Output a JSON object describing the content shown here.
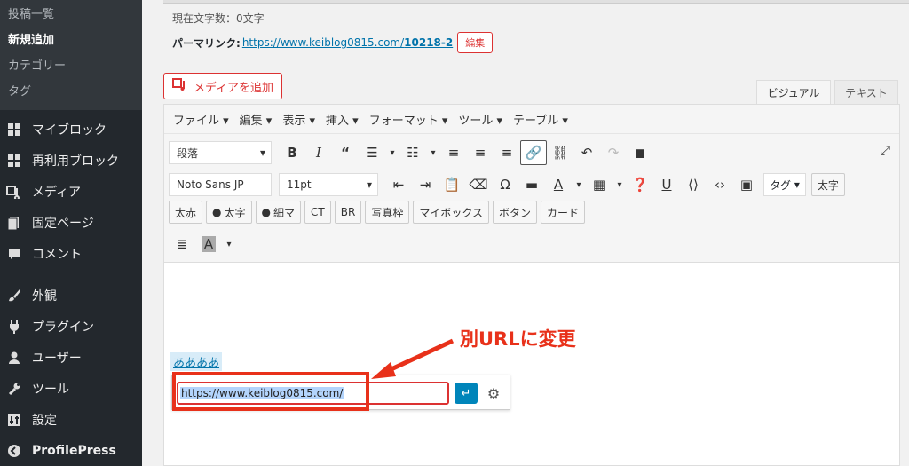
{
  "sidebar": {
    "submenu": [
      {
        "label": "投稿一覧",
        "current": false
      },
      {
        "label": "新規追加",
        "current": true
      },
      {
        "label": "カテゴリー",
        "current": false
      },
      {
        "label": "タグ",
        "current": false
      }
    ],
    "items": [
      {
        "label": "マイブロック",
        "icon": "grid-icon"
      },
      {
        "label": "再利用ブロック",
        "icon": "grid-icon"
      },
      {
        "label": "メディア",
        "icon": "media-icon"
      },
      {
        "label": "固定ページ",
        "icon": "page-icon"
      },
      {
        "label": "コメント",
        "icon": "comment-icon"
      },
      {
        "label": "外観",
        "icon": "brush-icon"
      },
      {
        "label": "プラグイン",
        "icon": "plugin-icon"
      },
      {
        "label": "ユーザー",
        "icon": "user-icon"
      },
      {
        "label": "ツール",
        "icon": "wrench-icon"
      },
      {
        "label": "設定",
        "icon": "settings-icon"
      },
      {
        "label": "ProfilePress",
        "icon": "profilepress-icon"
      }
    ]
  },
  "header": {
    "word_count": "現在文字数：0文字",
    "permalink_label": "パーマリンク:",
    "permalink_base": "https://www.keiblog0815.com/",
    "permalink_slug": "10218-2",
    "edit_label": "編集"
  },
  "media_button": "メディアを追加",
  "tabs": {
    "visual": "ビジュアル",
    "text": "テキスト"
  },
  "menubar": [
    "ファイル ▾",
    "編集 ▾",
    "表示 ▾",
    "挿入 ▾",
    "フォーマット ▾",
    "ツール ▾",
    "テーブル ▾"
  ],
  "toolbar": {
    "format_select": "段落",
    "font_select": "Noto Sans JP",
    "size_select": "11pt",
    "tag_select": "タグ",
    "futoji": "太字",
    "quicktags": [
      "太赤",
      "太字",
      "細マ",
      "CT",
      "BR",
      "写真枠",
      "マイボックス",
      "ボタン",
      "カード"
    ]
  },
  "content": {
    "link_text": "ああああ",
    "url_value": "https://www.keiblog0815.com/"
  },
  "annotation": "別URLに変更",
  "colors": {
    "accent_red": "#e8311a",
    "link_blue": "#0073aa",
    "sidebar_bg": "#23282d"
  }
}
